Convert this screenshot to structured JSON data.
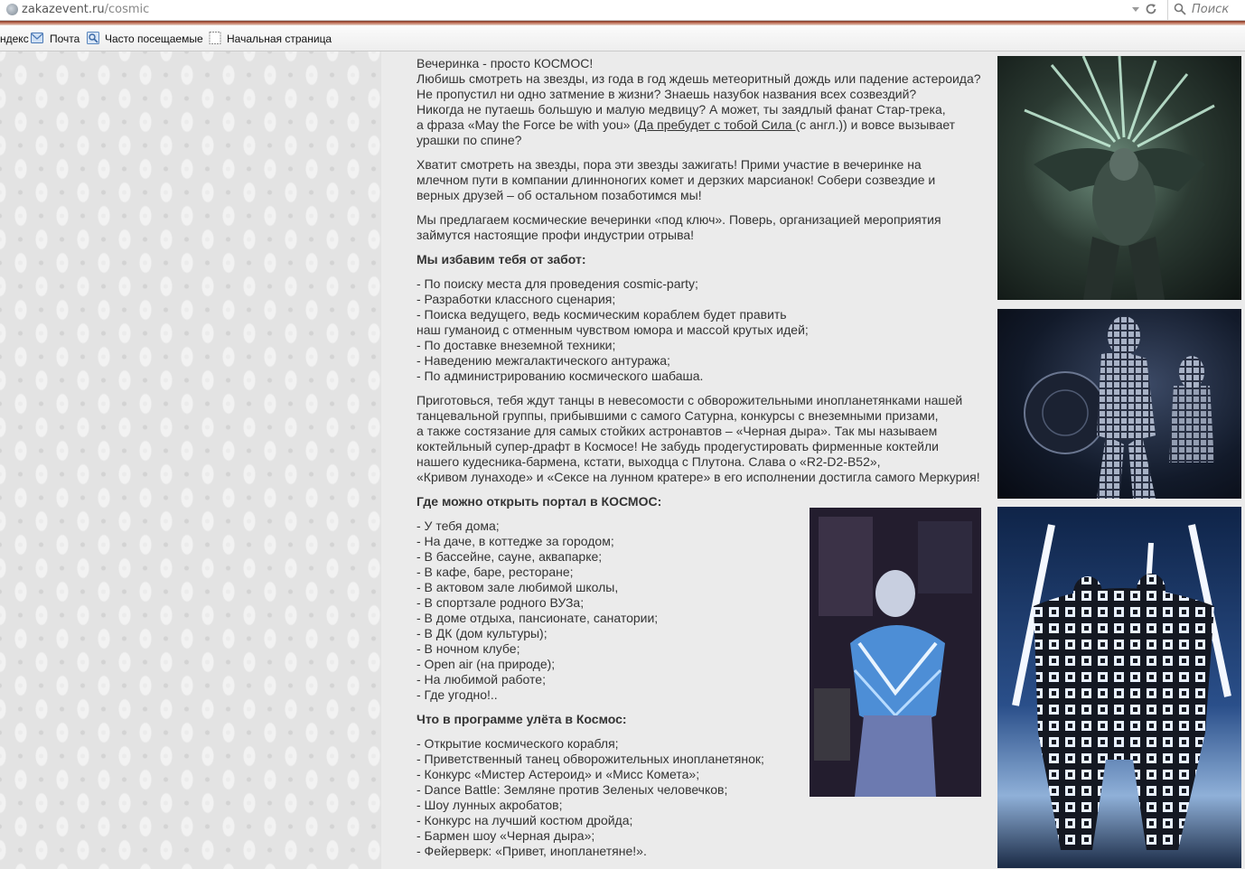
{
  "browser": {
    "url_domain": "zakazevent.ru",
    "url_path": "/cosmic",
    "search_placeholder": "Поиск",
    "bookmarks": [
      {
        "label": "ндекс"
      },
      {
        "label": "Почта"
      },
      {
        "label": "Часто посещаемые"
      },
      {
        "label": "Начальная страница"
      }
    ]
  },
  "article": {
    "intro_p1_before_link": "Вечеринка - просто КОСМОС!\n Любишь смотреть на звезды, из года в год ждешь метеоритный дождь или падение астероида?\nНе пропустил ни одно затмение в жизни? Знаешь назубок названия всех созвездий?\nНикогда не путаешь большую и малую медвицу? А может, ты заядлый фанат Стар-трека,\nа фраза «May the Force be with you» (",
    "intro_p1_link": "Да пребудет с тобой Сила ",
    "intro_p1_after_link": "(с англ.)) и вовсе вызывает\nурашки по спине?",
    "p2": " Хватит смотреть на звезды, пора эти звезды зажигать! Прими участие в вечеринке на\nмлечном пути в компании длинноногих комет и дерзких марсианок! Собери созвездие и\nверных друзей – об остальном позаботимся мы!",
    "p3": " Мы предлагаем космические вечеринки «под ключ». Поверь, организацией мероприятия\nзаймутся настоящие профи индустрии отрыва!",
    "h1": " Мы избавим тебя от забот:",
    "list1": "- По поиску места для проведения cosmic-party;\n- Разработки классного сценария;\n- Поиска ведущего, ведь космическим кораблем будет править\nнаш гуманоид с отменным чувством юмора и массой крутых идей;\n- По доставке внеземной техники;\n- Наведению межгалактического антуража;\n- По администрированию космического шабаша.",
    "p4": " Приготовься, тебя ждут танцы в невесомости с обворожительными инопланетянками нашей\nтанцевальной группы, прибывшими с самого Сатурна, конкурсы с внеземными призами,\nа также состязание для самых стойких астронавтов – «Черная дыра». Так мы называем\nкоктейльный супер-драфт в Космосе! Не забудь продегустировать фирменные коктейли\nнашего кудесника-бармена, кстати, выходца с Плутона. Слава о «R2-D2-B52»,\n«Кривом лунаходе» и «Сексе на лунном кратере» в его исполнении достигла самого Меркурия!",
    "h2": "Где можно открыть портал в КОСМОС:",
    "list2": "- У тебя дома;\n- На даче, в коттедже за городом;\n- В бассейне, сауне, аквапарке;\n- В кафе, баре, ресторане;\n- В актовом зале любимой школы,\n- В спортзале родного ВУЗа;\n- В доме отдыха, пансионате, санатории;\n- В ДК (дом культуры);\n- В ночном клубе;\n- Open air (на природе);\n- На любимой работе;\n- Где угодно!..",
    "h3": "Что в программе улёта в Космос:",
    "list3": "- Открытие космического корабля;\n- Приветственный танец обворожительных инопланетянок;\n- Конкурс «Мистер Астероид» и «Мисс Комета»;\n- Dance Battle: Земляне против Зеленых человечков;\n- Шоу лунных акробатов;\n- Конкурс на лучший костюм дройда;\n- Бармен шоу «Черная дыра»;\n- Фейерверк: «Привет, инопланетяне!»."
  },
  "colors": {
    "content_bg": "#ebebeb",
    "text": "#333333",
    "pattern_bg": "#e3e3e3"
  }
}
